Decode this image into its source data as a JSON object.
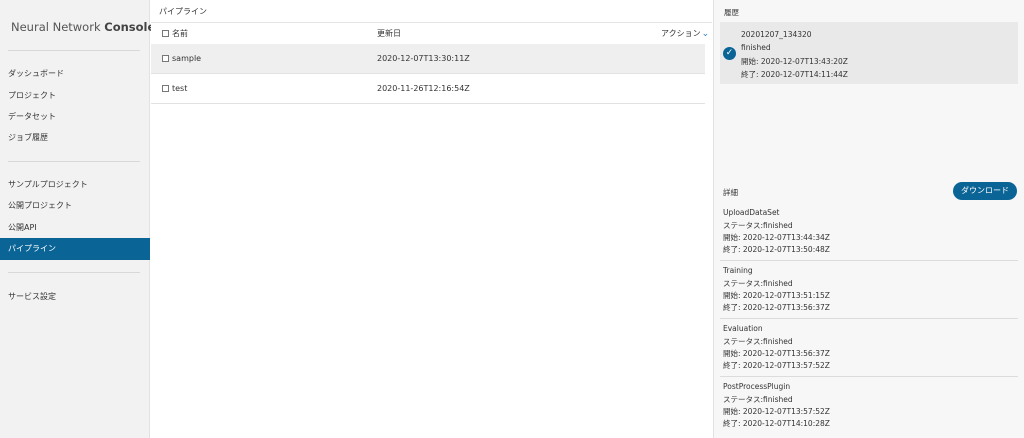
{
  "sidebar": {
    "brand_light": "Neural Network ",
    "brand_bold": "Console",
    "items": [
      {
        "label": "ダッシュボード"
      },
      {
        "label": "プロジェクト"
      },
      {
        "label": "データセット"
      },
      {
        "label": "ジョブ履歴"
      },
      {
        "label": "サンプルプロジェクト"
      },
      {
        "label": "公開プロジェクト"
      },
      {
        "label": "公開API"
      },
      {
        "label": "パイプライン"
      },
      {
        "label": "サービス設定"
      }
    ],
    "active_index": 7
  },
  "main": {
    "title": "パイプライン",
    "columns": {
      "name": "名前",
      "updated": "更新日",
      "action": "アクション"
    },
    "rows": [
      {
        "name": "sample",
        "updated": "2020-12-07T13:30:11Z",
        "selected": true
      },
      {
        "name": "test",
        "updated": "2020-11-26T12:16:54Z",
        "selected": false
      }
    ]
  },
  "history": {
    "title": "履歴",
    "entry": {
      "id": "20201207_134320",
      "status": "finished",
      "start": "開始: 2020-12-07T13:43:20Z",
      "end": "終了: 2020-12-07T14:11:44Z"
    }
  },
  "details": {
    "title": "詳細",
    "download_label": "ダウンロード",
    "steps": [
      {
        "name": "UploadDataSet",
        "status": "ステータス:finished",
        "start": "開始: 2020-12-07T13:44:34Z",
        "end": "終了: 2020-12-07T13:50:48Z"
      },
      {
        "name": "Training",
        "status": "ステータス:finished",
        "start": "開始: 2020-12-07T13:51:15Z",
        "end": "終了: 2020-12-07T13:56:37Z"
      },
      {
        "name": "Evaluation",
        "status": "ステータス:finished",
        "start": "開始: 2020-12-07T13:56:37Z",
        "end": "終了: 2020-12-07T13:57:52Z"
      },
      {
        "name": "PostProcessPlugin",
        "status": "ステータス:finished",
        "start": "開始: 2020-12-07T13:57:52Z",
        "end": "終了: 2020-12-07T14:10:28Z"
      }
    ]
  },
  "colors": {
    "accent": "#0a6496",
    "sidebar_bg": "#f2f2f2",
    "panel_bg": "#f7f7f7"
  },
  "icons": {
    "checkbox": "checkbox-icon",
    "chevron": "chevron-down-icon",
    "check": "check-circle-icon"
  }
}
